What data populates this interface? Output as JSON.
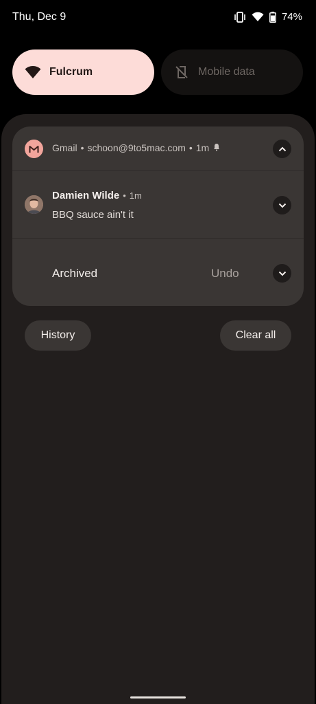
{
  "status_bar": {
    "date": "Thu, Dec 9",
    "battery": "74%",
    "icons": [
      "vibrate-icon",
      "wifi-icon",
      "battery-icon"
    ]
  },
  "quick_settings": {
    "wifi": {
      "label": "Fulcrum",
      "icon": "wifi-icon",
      "active": true
    },
    "mobile_data": {
      "label": "Mobile data",
      "icon": "mobile-data-off-icon",
      "active": false
    }
  },
  "notification": {
    "app_name": "Gmail",
    "account": "schoon@9to5mac.com",
    "time": "1m",
    "separator": "•",
    "message": {
      "sender": "Damien Wilde",
      "time": "1m",
      "text": "BBQ sauce ain't it"
    },
    "archived_label": "Archived",
    "undo_label": "Undo"
  },
  "actions": {
    "history": "History",
    "clear_all": "Clear all"
  },
  "colors": {
    "tile_active": "#fddcd8",
    "shade_bg": "#221e1d",
    "card_bg": "#3a3634",
    "gmail_accent": "#f2a59c"
  }
}
